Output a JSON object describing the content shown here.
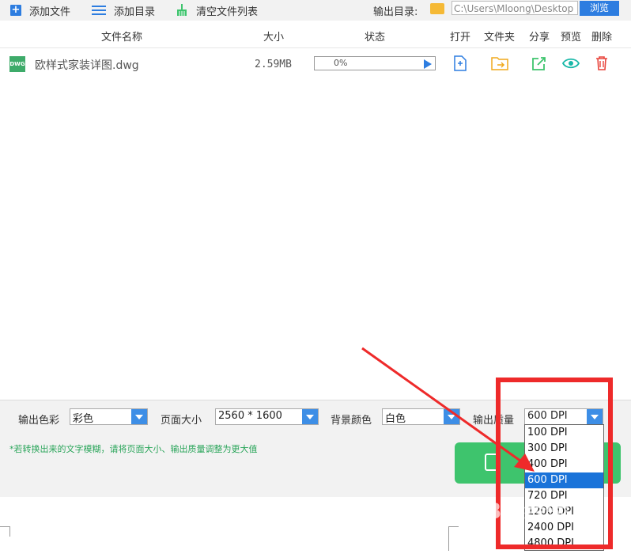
{
  "toolbar": {
    "add_file": "添加文件",
    "add_dir": "添加目录",
    "clear_list": "清空文件列表",
    "output_dir_label": "输出目录:",
    "output_path": "C:\\Users\\Mloong\\Desktop",
    "browse": "浏览"
  },
  "table": {
    "headers": {
      "name": "文件名称",
      "size": "大小",
      "status": "状态",
      "open": "打开",
      "folder": "文件夹",
      "share": "分享",
      "preview": "预览",
      "delete": "删除"
    },
    "rows": [
      {
        "icon_text": "DWG",
        "name": "欧样式家装详图.dwg",
        "size": "2.59MB",
        "progress": "0%"
      }
    ]
  },
  "options": {
    "color_label": "输出色彩",
    "color_value": "彩色",
    "page_size_label": "页面大小",
    "page_size_value": "2560 * 1600",
    "bg_label": "背景颜色",
    "bg_value": "白色",
    "quality_label": "输出质量",
    "quality_value": "600 DPI",
    "hint": "*若转换出来的文字模糊，请将页面大小、输出质量调整为更大值"
  },
  "quality_options": [
    "100 DPI",
    "300 DPI",
    "400 DPI",
    "600 DPI",
    "720 DPI",
    "1200 DPI",
    "2400 DPI",
    "4800 DPI"
  ],
  "quality_selected_index": 3,
  "watermark": "Bai经验",
  "colors": {
    "accent": "#2d7de0",
    "green": "#3ec46d",
    "annotation_red": "#ee2a2a"
  }
}
